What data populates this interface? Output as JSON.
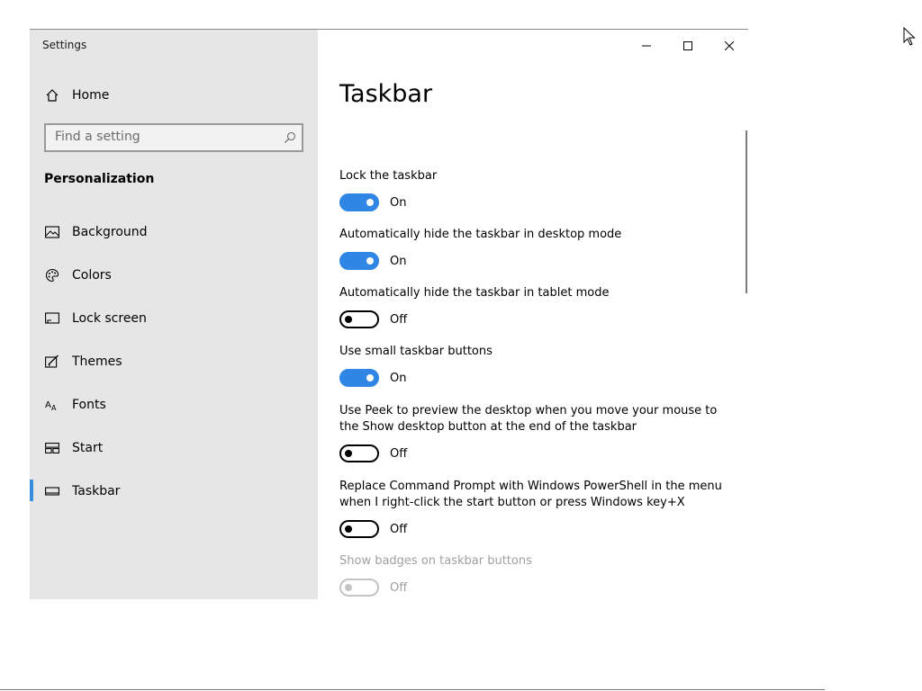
{
  "window": {
    "title": "Settings",
    "controls": {
      "minimize": "minimize-icon",
      "maximize": "maximize-icon",
      "close": "close-icon"
    }
  },
  "sidebar": {
    "home_label": "Home",
    "search_placeholder": "Find a setting",
    "section_heading": "Personalization",
    "items": [
      {
        "label": "Background",
        "icon": "picture-icon"
      },
      {
        "label": "Colors",
        "icon": "palette-icon"
      },
      {
        "label": "Lock screen",
        "icon": "lock-screen-icon"
      },
      {
        "label": "Themes",
        "icon": "themes-icon"
      },
      {
        "label": "Fonts",
        "icon": "fonts-icon"
      },
      {
        "label": "Start",
        "icon": "start-icon"
      },
      {
        "label": "Taskbar",
        "icon": "taskbar-icon",
        "selected": true
      }
    ]
  },
  "main": {
    "title": "Taskbar",
    "settings": [
      {
        "label": "Lock the taskbar",
        "state": "On"
      },
      {
        "label": "Automatically hide the taskbar in desktop mode",
        "state": "On"
      },
      {
        "label": "Automatically hide the taskbar in tablet mode",
        "state": "Off"
      },
      {
        "label": "Use small taskbar buttons",
        "state": "On"
      },
      {
        "label": "Use Peek to preview the desktop when you move your mouse to the Show desktop button at the end of the taskbar",
        "state": "Off"
      },
      {
        "label": "Replace Command Prompt with Windows PowerShell in the menu when I right-click the start button or press Windows key+X",
        "state": "Off"
      },
      {
        "label": "Show badges on taskbar buttons",
        "state": "Off",
        "disabled": true
      }
    ]
  },
  "colors": {
    "accent": "#2f86e4",
    "sidebar_bg": "#e6e6e6",
    "disabled_text": "#a0a0a0"
  }
}
